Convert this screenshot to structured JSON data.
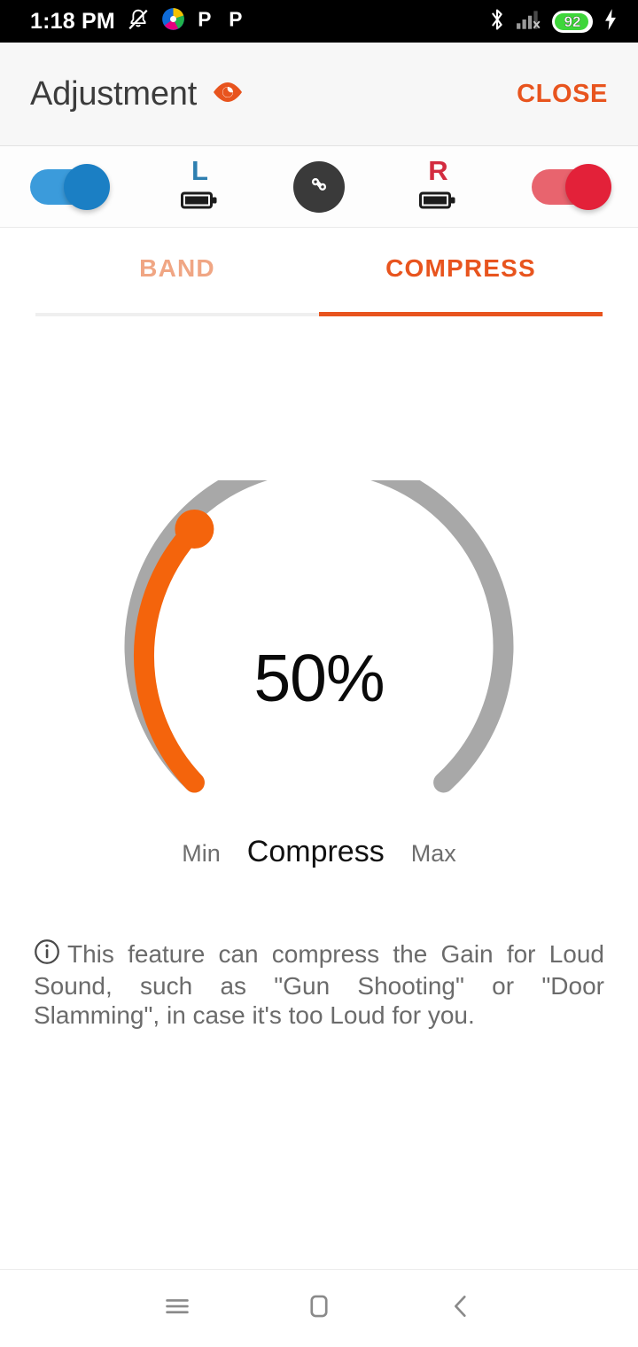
{
  "statusbar": {
    "time": "1:18 PM",
    "left_icons": [
      "notifications-muted-icon",
      "pinwheel-app-icon",
      "p-app-icon",
      "p-app-icon"
    ],
    "right_icons": [
      "bluetooth-icon",
      "signal-no-sim-icon",
      "battery-icon",
      "charging-bolt-icon"
    ],
    "battery_level": "92",
    "battery_color": "#3ED63A"
  },
  "appbar": {
    "title": "Adjustment",
    "eye_icon": "eye-icon",
    "close_label": "CLOSE",
    "accent": "#E8541E"
  },
  "devicebar": {
    "left_toggle": {
      "name": "left-device-toggle",
      "state": "on",
      "color": "#3B9BDB",
      "knob_color": "#1B7FC4"
    },
    "left_side": {
      "letter": "L",
      "color": "#2E7FB0",
      "battery_icon": "battery-full-icon"
    },
    "link": {
      "name": "link-devices-button",
      "icon": "chain-link-icon",
      "color": "#3A3A3A"
    },
    "right_side": {
      "letter": "R",
      "color": "#D32B3F",
      "battery_icon": "battery-full-icon"
    },
    "right_toggle": {
      "name": "right-device-toggle",
      "state": "on",
      "color": "#E8646E",
      "knob_color": "#E32139"
    }
  },
  "tabs": [
    {
      "label": "BAND",
      "active": false,
      "color": "#F0A684"
    },
    {
      "label": "COMPRESS",
      "active": true,
      "color": "#E8541E"
    }
  ],
  "gauge": {
    "value_text": "50%",
    "value": 50,
    "min_label": "Min",
    "max_label": "Max",
    "name_label": "Compress",
    "fill_color": "#F4640C",
    "track_color": "#A8A8A8",
    "thumb_color": "#F4640C"
  },
  "info": {
    "icon": "info-circle-icon",
    "text": "This feature can compress the Gain for Loud Sound, such as \"Gun Shooting\" or \"Door Slamming\", in case it's too Loud for you."
  },
  "navbar": {
    "items": [
      {
        "name": "recents-button",
        "icon": "hamburger-icon"
      },
      {
        "name": "home-button",
        "icon": "rounded-square-icon"
      },
      {
        "name": "back-button",
        "icon": "chevron-left-icon"
      }
    ],
    "color": "#8A8A8A"
  }
}
